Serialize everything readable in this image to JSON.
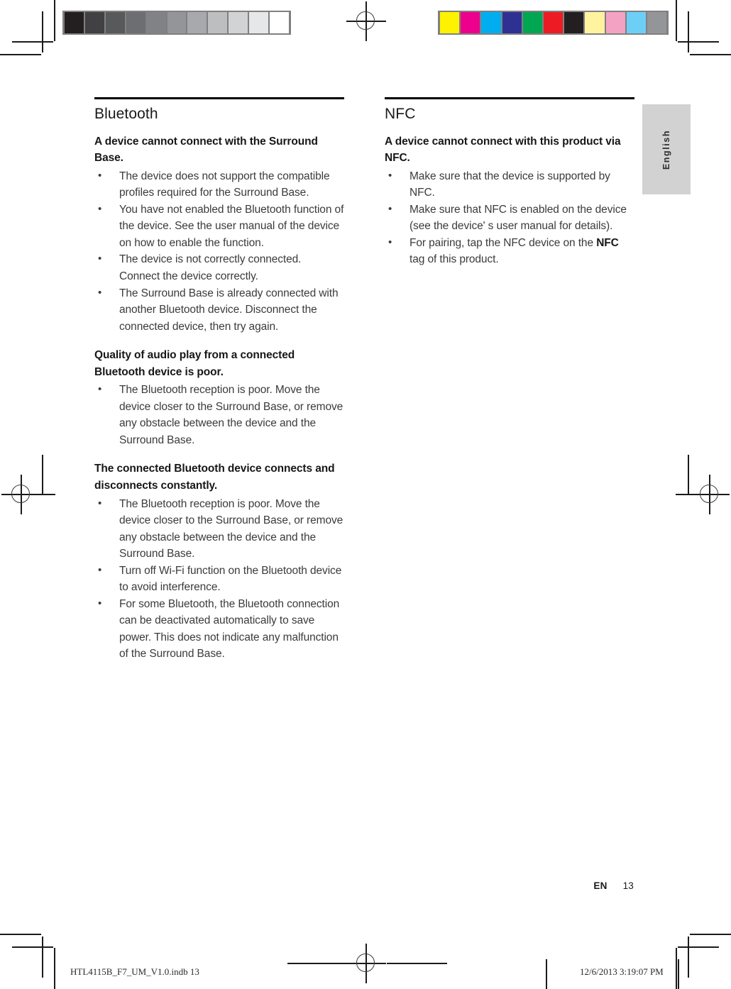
{
  "document": {
    "language_tab": "English",
    "footer": {
      "language_code": "EN",
      "page_number": "13"
    },
    "print_slug": {
      "filename": "HTL4115B_F7_UM_V1.0.indb   13",
      "timestamp": "12/6/2013   3:19:07 PM"
    }
  },
  "left_column": {
    "title": "Bluetooth",
    "blocks": [
      {
        "heading": "A device cannot connect with the Surround Base.",
        "bullets": [
          "The device does not support the compatible profiles required for the Surround Base.",
          "You have not enabled the Bluetooth function of the device. See the user manual of the device on how to enable the function.",
          "The device is not correctly connected. Connect the device correctly.",
          "The Surround Base is already connected with another Bluetooth device. Disconnect the connected device, then try again."
        ]
      },
      {
        "heading": "Quality of audio play from a connected Bluetooth device is poor.",
        "bullets": [
          "The Bluetooth reception is poor. Move the device closer to the Surround Base, or remove any obstacle between the device and the Surround Base."
        ]
      },
      {
        "heading": "The connected Bluetooth device connects and disconnects constantly.",
        "bullets": [
          "The Bluetooth reception is poor. Move the device closer to the Surround Base, or remove any obstacle between the device and the Surround Base.",
          "Turn off Wi-Fi function on the Bluetooth device to avoid interference.",
          "For some Bluetooth, the Bluetooth connection can be deactivated automatically to save power. This does not indicate any malfunction of the Surround Base."
        ]
      }
    ]
  },
  "right_column": {
    "title": "NFC",
    "blocks": [
      {
        "heading": "A device cannot connect with this product via NFC.",
        "bullets": [
          "Make sure that the device is supported by NFC.",
          "Make sure that NFC is enabled on the device (see the device' s user manual for details)."
        ],
        "bullet_rich": [
          {
            "pre": "For pairing, tap the NFC device on the ",
            "bold": "NFC",
            "post": " tag of this product."
          }
        ]
      }
    ]
  },
  "print_marks": {
    "grayscale_strip": [
      "#231f20",
      "#414042",
      "#58595b",
      "#6d6e71",
      "#808285",
      "#939598",
      "#a7a9ac",
      "#bcbec0",
      "#d1d3d4",
      "#e6e7e8",
      "#ffffff"
    ],
    "color_strip": [
      "#fff200",
      "#ec008c",
      "#00aeef",
      "#2e3192",
      "#00a651",
      "#ed1c24",
      "#231f20",
      "#fff3a0",
      "#f4a2c4",
      "#6dcff6",
      "#939598"
    ],
    "strip_border": "#808080"
  }
}
